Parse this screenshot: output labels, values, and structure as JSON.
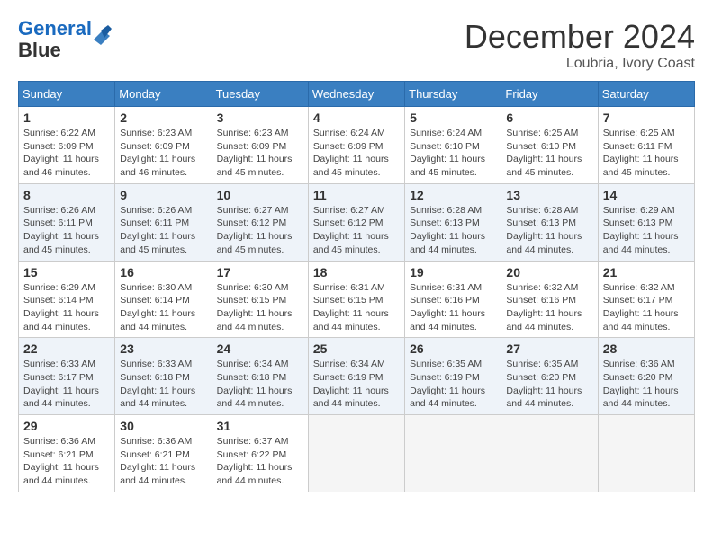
{
  "header": {
    "logo_line1": "General",
    "logo_line2": "Blue",
    "month_title": "December 2024",
    "location": "Loubria, Ivory Coast"
  },
  "weekdays": [
    "Sunday",
    "Monday",
    "Tuesday",
    "Wednesday",
    "Thursday",
    "Friday",
    "Saturday"
  ],
  "weeks": [
    [
      {
        "day": "1",
        "sunrise": "6:22 AM",
        "sunset": "6:09 PM",
        "daylight": "11 hours and 46 minutes."
      },
      {
        "day": "2",
        "sunrise": "6:23 AM",
        "sunset": "6:09 PM",
        "daylight": "11 hours and 46 minutes."
      },
      {
        "day": "3",
        "sunrise": "6:23 AM",
        "sunset": "6:09 PM",
        "daylight": "11 hours and 45 minutes."
      },
      {
        "day": "4",
        "sunrise": "6:24 AM",
        "sunset": "6:09 PM",
        "daylight": "11 hours and 45 minutes."
      },
      {
        "day": "5",
        "sunrise": "6:24 AM",
        "sunset": "6:10 PM",
        "daylight": "11 hours and 45 minutes."
      },
      {
        "day": "6",
        "sunrise": "6:25 AM",
        "sunset": "6:10 PM",
        "daylight": "11 hours and 45 minutes."
      },
      {
        "day": "7",
        "sunrise": "6:25 AM",
        "sunset": "6:11 PM",
        "daylight": "11 hours and 45 minutes."
      }
    ],
    [
      {
        "day": "8",
        "sunrise": "6:26 AM",
        "sunset": "6:11 PM",
        "daylight": "11 hours and 45 minutes."
      },
      {
        "day": "9",
        "sunrise": "6:26 AM",
        "sunset": "6:11 PM",
        "daylight": "11 hours and 45 minutes."
      },
      {
        "day": "10",
        "sunrise": "6:27 AM",
        "sunset": "6:12 PM",
        "daylight": "11 hours and 45 minutes."
      },
      {
        "day": "11",
        "sunrise": "6:27 AM",
        "sunset": "6:12 PM",
        "daylight": "11 hours and 45 minutes."
      },
      {
        "day": "12",
        "sunrise": "6:28 AM",
        "sunset": "6:13 PM",
        "daylight": "11 hours and 44 minutes."
      },
      {
        "day": "13",
        "sunrise": "6:28 AM",
        "sunset": "6:13 PM",
        "daylight": "11 hours and 44 minutes."
      },
      {
        "day": "14",
        "sunrise": "6:29 AM",
        "sunset": "6:13 PM",
        "daylight": "11 hours and 44 minutes."
      }
    ],
    [
      {
        "day": "15",
        "sunrise": "6:29 AM",
        "sunset": "6:14 PM",
        "daylight": "11 hours and 44 minutes."
      },
      {
        "day": "16",
        "sunrise": "6:30 AM",
        "sunset": "6:14 PM",
        "daylight": "11 hours and 44 minutes."
      },
      {
        "day": "17",
        "sunrise": "6:30 AM",
        "sunset": "6:15 PM",
        "daylight": "11 hours and 44 minutes."
      },
      {
        "day": "18",
        "sunrise": "6:31 AM",
        "sunset": "6:15 PM",
        "daylight": "11 hours and 44 minutes."
      },
      {
        "day": "19",
        "sunrise": "6:31 AM",
        "sunset": "6:16 PM",
        "daylight": "11 hours and 44 minutes."
      },
      {
        "day": "20",
        "sunrise": "6:32 AM",
        "sunset": "6:16 PM",
        "daylight": "11 hours and 44 minutes."
      },
      {
        "day": "21",
        "sunrise": "6:32 AM",
        "sunset": "6:17 PM",
        "daylight": "11 hours and 44 minutes."
      }
    ],
    [
      {
        "day": "22",
        "sunrise": "6:33 AM",
        "sunset": "6:17 PM",
        "daylight": "11 hours and 44 minutes."
      },
      {
        "day": "23",
        "sunrise": "6:33 AM",
        "sunset": "6:18 PM",
        "daylight": "11 hours and 44 minutes."
      },
      {
        "day": "24",
        "sunrise": "6:34 AM",
        "sunset": "6:18 PM",
        "daylight": "11 hours and 44 minutes."
      },
      {
        "day": "25",
        "sunrise": "6:34 AM",
        "sunset": "6:19 PM",
        "daylight": "11 hours and 44 minutes."
      },
      {
        "day": "26",
        "sunrise": "6:35 AM",
        "sunset": "6:19 PM",
        "daylight": "11 hours and 44 minutes."
      },
      {
        "day": "27",
        "sunrise": "6:35 AM",
        "sunset": "6:20 PM",
        "daylight": "11 hours and 44 minutes."
      },
      {
        "day": "28",
        "sunrise": "6:36 AM",
        "sunset": "6:20 PM",
        "daylight": "11 hours and 44 minutes."
      }
    ],
    [
      {
        "day": "29",
        "sunrise": "6:36 AM",
        "sunset": "6:21 PM",
        "daylight": "11 hours and 44 minutes."
      },
      {
        "day": "30",
        "sunrise": "6:36 AM",
        "sunset": "6:21 PM",
        "daylight": "11 hours and 44 minutes."
      },
      {
        "day": "31",
        "sunrise": "6:37 AM",
        "sunset": "6:22 PM",
        "daylight": "11 hours and 44 minutes."
      },
      null,
      null,
      null,
      null
    ]
  ]
}
